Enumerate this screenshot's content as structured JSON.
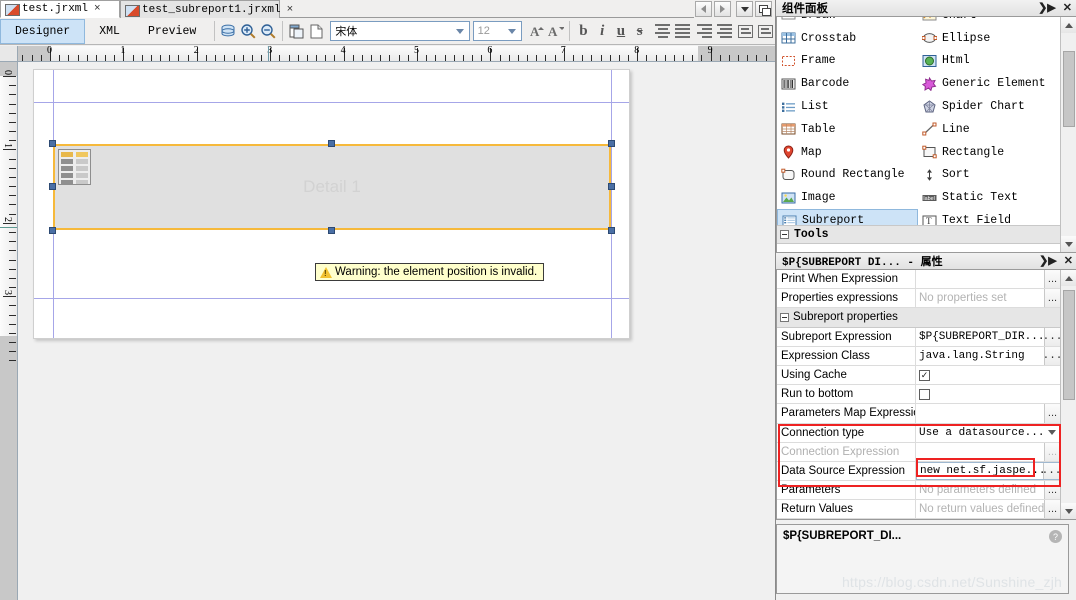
{
  "doc_tabs": [
    {
      "label": "test.jrxml",
      "close": "×",
      "active": true
    },
    {
      "label": "test_subreport1.jrxml",
      "close": "×",
      "active": false
    }
  ],
  "view_tabs": [
    {
      "label": "Designer",
      "active": true
    },
    {
      "label": "XML",
      "active": false
    },
    {
      "label": "Preview",
      "active": false
    }
  ],
  "toolbar": {
    "icons": [
      "database-icon",
      "zoom-in-icon",
      "zoom-out-icon",
      "report-properties-icon",
      "page-format-icon"
    ],
    "font_family": "宋体",
    "font_size": "12",
    "increase_font_label": "A",
    "decrease_font_label": "A",
    "bold_label": "b",
    "italic_label": "i",
    "underline_label": "u",
    "strike_label": "s",
    "align_labels": [
      "align-left",
      "align-center",
      "align-right",
      "align-justify"
    ],
    "valign_labels": [
      "valign-top",
      "valign-middle"
    ]
  },
  "ruler": {
    "h_labels": [
      "0",
      "1",
      "2",
      "3",
      "4",
      "5",
      "6",
      "7",
      "8",
      "9"
    ],
    "v_labels": [
      "0",
      "1",
      "2",
      "3"
    ]
  },
  "canvas": {
    "band_label": "Detail 1",
    "element_name": "subreport-element",
    "warning_text": "Warning: the element position is invalid.",
    "warning_icon": "warning-triangle-icon"
  },
  "palette": {
    "title": "组件面板",
    "collapse_icon": "❯▶",
    "close_icon": "✕",
    "rows": [
      {
        "left": {
          "label": "Break",
          "icon": "break-icon"
        },
        "right": {
          "label": "Chart",
          "icon": "chart-icon"
        }
      },
      {
        "left": {
          "label": "Crosstab",
          "icon": "crosstab-icon"
        },
        "right": {
          "label": "Ellipse",
          "icon": "ellipse-icon"
        }
      },
      {
        "left": {
          "label": "Frame",
          "icon": "frame-icon"
        },
        "right": {
          "label": "Html",
          "icon": "html-icon"
        }
      },
      {
        "left": {
          "label": "Barcode",
          "icon": "barcode-icon"
        },
        "right": {
          "label": "Generic Element",
          "icon": "generic-element-icon"
        }
      },
      {
        "left": {
          "label": "List",
          "icon": "list-icon"
        },
        "right": {
          "label": "Spider Chart",
          "icon": "spider-chart-icon"
        }
      },
      {
        "left": {
          "label": "Table",
          "icon": "table-icon"
        },
        "right": {
          "label": "Line",
          "icon": "line-icon"
        }
      },
      {
        "left": {
          "label": "Map",
          "icon": "map-icon"
        },
        "right": {
          "label": "Rectangle",
          "icon": "rectangle-icon"
        }
      },
      {
        "left": {
          "label": "Round Rectangle",
          "icon": "round-rectangle-icon"
        },
        "right": {
          "label": "Sort",
          "icon": "sort-icon"
        }
      },
      {
        "left": {
          "label": "Image",
          "icon": "image-icon"
        },
        "right": {
          "label": "Static Text",
          "icon": "static-text-icon"
        }
      },
      {
        "left": {
          "label": "Subreport",
          "icon": "subreport-icon",
          "selected": true
        },
        "right": {
          "label": "Text Field",
          "icon": "text-field-icon"
        }
      }
    ],
    "section_label": "Tools"
  },
  "properties": {
    "title": "$P{SUBREPORT DI... - 属性",
    "collapse_icon": "❯▶",
    "close_icon": "✕",
    "rows": [
      {
        "name": "Print When Expression",
        "value": "",
        "kind": "text",
        "dots": true
      },
      {
        "name": "Properties expressions",
        "value": "No properties set",
        "kind": "placeholder",
        "dots": true
      },
      {
        "name": "Subreport properties",
        "kind": "group"
      },
      {
        "name": "Subreport Expression",
        "value": "$P{SUBREPORT_DIR...",
        "kind": "mono",
        "dots": true
      },
      {
        "name": "Expression Class",
        "value": "java.lang.String",
        "kind": "select",
        "dots": true
      },
      {
        "name": "Using Cache",
        "value": "✓",
        "kind": "checkbox-checked"
      },
      {
        "name": "Run to bottom",
        "value": "",
        "kind": "checkbox"
      },
      {
        "name": "Parameters Map Expression",
        "value": "",
        "kind": "text",
        "dots": true
      },
      {
        "name": "Connection type",
        "value": "Use a datasource...",
        "kind": "select",
        "highlight": true
      },
      {
        "name": "Connection Expression",
        "value": "",
        "kind": "text",
        "dots": true,
        "disabled": true
      },
      {
        "name": "Data Source Expression",
        "value": "new net.sf.jaspe...",
        "kind": "mono",
        "dots": true,
        "boxed": true
      },
      {
        "name": "Parameters",
        "value": "No parameters defined",
        "kind": "placeholder",
        "dots": true
      },
      {
        "name": "Return Values",
        "value": "No return values defined",
        "kind": "placeholder",
        "dots": true
      }
    ]
  },
  "description": {
    "title": "$P{SUBREPORT_DI...",
    "help_icon": "?"
  },
  "watermark": "https://blog.csdn.net/Sunshine_zjh",
  "colors": {
    "selection_orange": "#f6b93b",
    "highlight_red": "#ee2222",
    "select_blue": "#cde3f7",
    "band_gray": "#e0e0e0"
  }
}
